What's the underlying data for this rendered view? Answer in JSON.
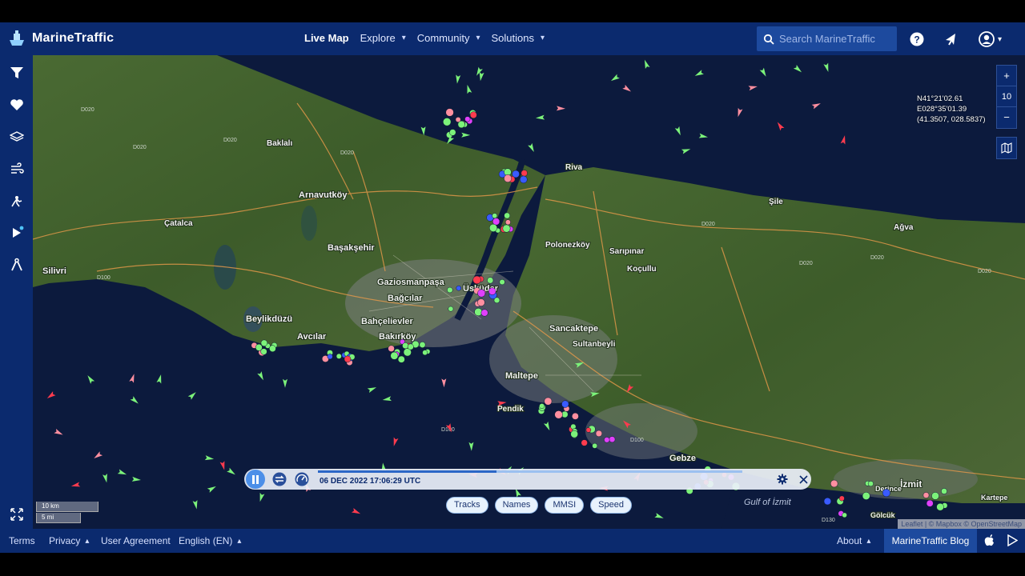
{
  "brand": {
    "name": "MarineTraffic"
  },
  "nav": {
    "live_map": "Live Map",
    "explore": "Explore",
    "community": "Community",
    "solutions": "Solutions"
  },
  "search": {
    "placeholder": "Search MarineTraffic"
  },
  "top_icons": [
    "help-icon",
    "notifications-icon",
    "account-icon"
  ],
  "sidebar": {
    "items": [
      "filter-icon",
      "favorites-icon",
      "layers-icon",
      "weather-icon",
      "density-icon",
      "playback-icon",
      "measure-icon"
    ]
  },
  "map": {
    "zoom_in": "+",
    "zoom_level": "10",
    "zoom_out": "−",
    "coords": {
      "lat": "N41°21'02.61",
      "lon": "E028°35'01.39",
      "decimal": "(41.3507, 028.5837)"
    },
    "scale": {
      "km": "10 km",
      "mi": "5 mi"
    },
    "attribution": "Leaflet | © Mapbox © OpenStreetMap",
    "places": [
      {
        "name": "Baklalı",
        "size": "s"
      },
      {
        "name": "Arnavutköy",
        "size": "m"
      },
      {
        "name": "Çatalca",
        "size": "s"
      },
      {
        "name": "Silivri",
        "size": "m"
      },
      {
        "name": "Başakşehir",
        "size": "m"
      },
      {
        "name": "Gaziosmanpaşa",
        "size": "m"
      },
      {
        "name": "Bağcılar",
        "size": "m"
      },
      {
        "name": "Beylikdüzü",
        "size": "m"
      },
      {
        "name": "Avcılar",
        "size": "m"
      },
      {
        "name": "Bahçelievler",
        "size": "m"
      },
      {
        "name": "Bakırköy",
        "size": "m"
      },
      {
        "name": "Üsküdar",
        "size": "m"
      },
      {
        "name": "Sancaktepe",
        "size": "m"
      },
      {
        "name": "Sultanbeyli",
        "size": "s"
      },
      {
        "name": "Maltepe",
        "size": "m"
      },
      {
        "name": "Pendik",
        "size": "s"
      },
      {
        "name": "Gebze",
        "size": "m"
      },
      {
        "name": "Polonezköy",
        "size": "s"
      },
      {
        "name": "Sarıpınar",
        "size": "s"
      },
      {
        "name": "Koçullu",
        "size": "s"
      },
      {
        "name": "Riva",
        "size": "s"
      },
      {
        "name": "Şile",
        "size": "s"
      },
      {
        "name": "Ağva",
        "size": "s"
      },
      {
        "name": "Gulf of İzmit",
        "size": "m"
      },
      {
        "name": "İzmit",
        "size": "m"
      },
      {
        "name": "Derince",
        "size": "s"
      },
      {
        "name": "Gölcük",
        "size": "s"
      },
      {
        "name": "Kartepe",
        "size": "s"
      }
    ],
    "roads": [
      "D020",
      "D020",
      "D020",
      "D020",
      "D020",
      "D020",
      "D020",
      "D020",
      "D100",
      "D100",
      "D100",
      "D130"
    ]
  },
  "playback": {
    "datetime": "06 DEC 2022 17:06:29 UTC",
    "progress": 0.42,
    "chips": {
      "tracks": "Tracks",
      "names": "Names",
      "mmsi": "MMSI",
      "speed": "Speed"
    }
  },
  "footer": {
    "terms": "Terms",
    "privacy": "Privacy",
    "user_agreement": "User Agreement",
    "language": "English (EN)",
    "about": "About",
    "blog": "MarineTraffic Blog"
  },
  "colors": {
    "navy": "#0b2a6e",
    "sea": "#0c1a3d",
    "land": "#3f5e2c",
    "vessel_cargo": "#7cf27a",
    "vessel_tanker": "#ff3b4e",
    "vessel_passenger": "#3a5bff",
    "vessel_pleasure": "#e040fb",
    "vessel_other": "#ff8fa0"
  }
}
